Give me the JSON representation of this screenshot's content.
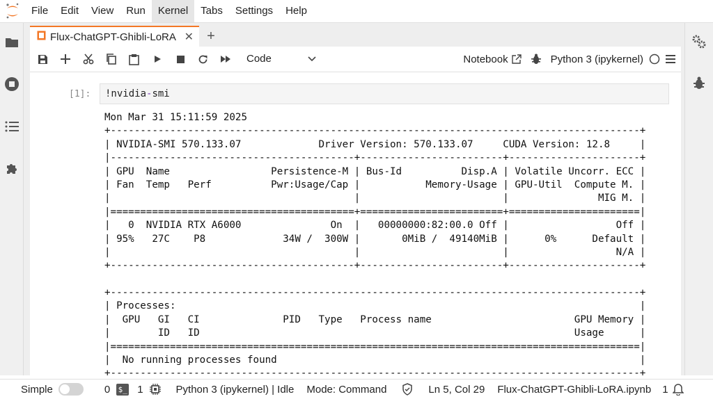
{
  "menubar": {
    "items": [
      "File",
      "Edit",
      "View",
      "Run",
      "Kernel",
      "Tabs",
      "Settings",
      "Help"
    ],
    "active": "Kernel"
  },
  "left_sidebar": {
    "icons": [
      "folder-icon",
      "running-icon",
      "toc-icon",
      "extensions-icon"
    ]
  },
  "right_sidebar": {
    "icons": [
      "property-inspector-icon",
      "debugger-icon"
    ]
  },
  "tab": {
    "title": "Flux-ChatGPT-Ghibli-LoRA",
    "close": "✕",
    "add": "+"
  },
  "toolbar": {
    "cell_type": "Code",
    "notebook_label": "Notebook",
    "kernel_name": "Python 3 (ipykernel)"
  },
  "cell": {
    "prompt": "[1]:",
    "input_prefix": "!nvidia",
    "input_dash": "-",
    "input_suffix": "smi",
    "output_lines": [
      "Mon Mar 31 15:11:59 2025",
      "+-----------------------------------------------------------------------------------------+",
      "| NVIDIA-SMI 570.133.07             Driver Version: 570.133.07     CUDA Version: 12.8     |",
      "|-----------------------------------------+------------------------+----------------------+",
      "| GPU  Name                 Persistence-M | Bus-Id          Disp.A | Volatile Uncorr. ECC |",
      "| Fan  Temp   Perf          Pwr:Usage/Cap |           Memory-Usage | GPU-Util  Compute M. |",
      "|                                         |                        |               MIG M. |",
      "|=========================================+========================+======================|",
      "|   0  NVIDIA RTX A6000               On  |   00000000:82:00.0 Off |                  Off |",
      "| 95%   27C    P8             34W /  300W |       0MiB /  49140MiB |      0%      Default |",
      "|                                         |                        |                  N/A |",
      "+-----------------------------------------+------------------------+----------------------+",
      "",
      "+-----------------------------------------------------------------------------------------+",
      "| Processes:                                                                              |",
      "|  GPU   GI   CI              PID   Type   Process name                        GPU Memory |",
      "|        ID   ID                                                               Usage      |",
      "|=========================================================================================|",
      "|  No running processes found                                                             |",
      "+-----------------------------------------------------------------------------------------+"
    ]
  },
  "statusbar": {
    "mode_label": "Simple",
    "terminals_count": "0",
    "kernels_count": "1",
    "kernel_status": "Python 3 (ipykernel) | Idle",
    "mode": "Mode: Command",
    "cursor": "Ln 5, Col 29",
    "filename": "Flux-ChatGPT-Ghibli-LoRA.ipynb",
    "notifications": "1"
  },
  "colors": {
    "accent": "#f37726",
    "input_keyword": "#7a3fb8"
  }
}
